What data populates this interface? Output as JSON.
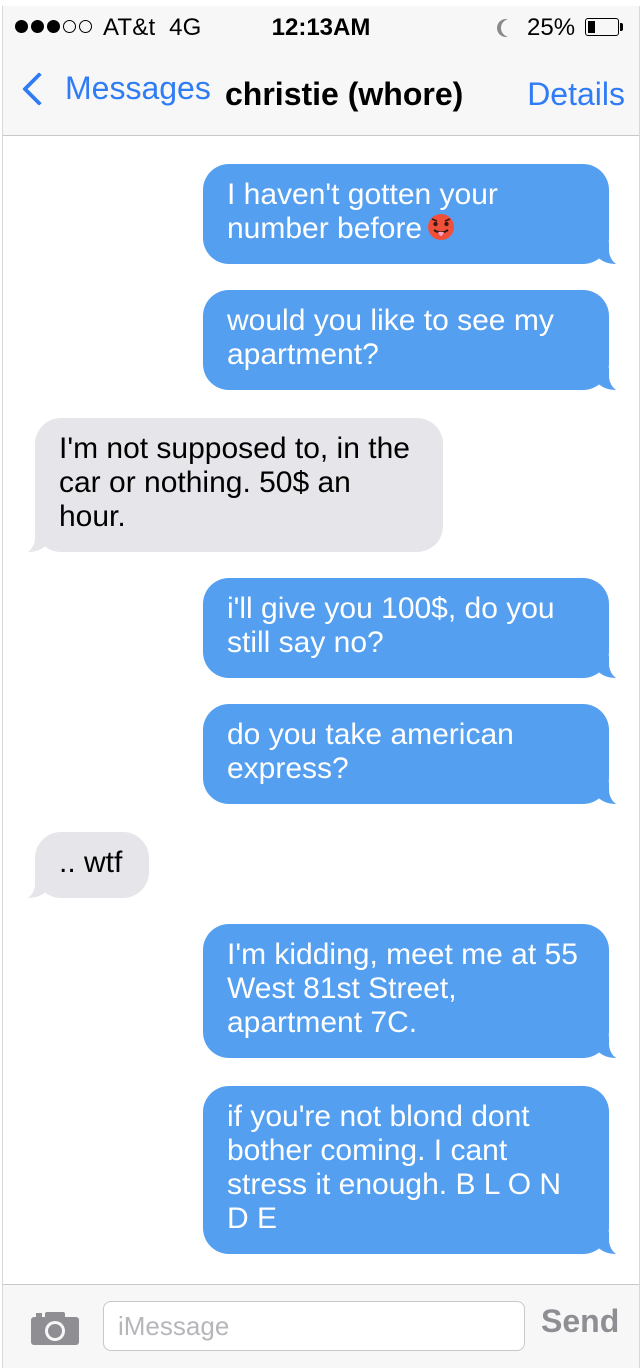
{
  "status_bar": {
    "signal_full_dots": 3,
    "signal_total_dots": 5,
    "carrier": "AT&t  4G",
    "time": "12:13AM",
    "battery_percent": "25%",
    "battery_level": 0.25
  },
  "nav": {
    "back_label": "Messages",
    "contact_name": "christie (whore)",
    "details_label": "Details"
  },
  "messages": [
    {
      "direction": "sent",
      "text": "I haven't gotten your number before",
      "emoji": "hot-face"
    },
    {
      "direction": "sent",
      "text": "would you like to see my apartment?"
    },
    {
      "direction": "received",
      "text": "I'm not supposed to, in the car or nothing. 50$ an hour."
    },
    {
      "direction": "sent",
      "text": "i'll give you 100$, do you still say no?"
    },
    {
      "direction": "sent",
      "text": "do you take american express?"
    },
    {
      "direction": "received",
      "text": ".. wtf"
    },
    {
      "direction": "sent",
      "text": "I'm kidding, meet me at 55 West 81st Street, apartment 7C."
    },
    {
      "direction": "sent",
      "text": "if you're not blond dont bother coming. I cant stress it enough. B L O N D E"
    }
  ],
  "input": {
    "placeholder": "iMessage",
    "send_label": "Send"
  },
  "colors": {
    "accent": "#2f7cf6",
    "sent_bubble": "#549ff0",
    "received_bubble": "#e5e5ea",
    "send_disabled": "#8e8e93"
  },
  "icons": {
    "back": "chevron-left-icon",
    "camera": "camera-icon",
    "battery": "battery-icon",
    "do_not_disturb": "moon-icon"
  }
}
